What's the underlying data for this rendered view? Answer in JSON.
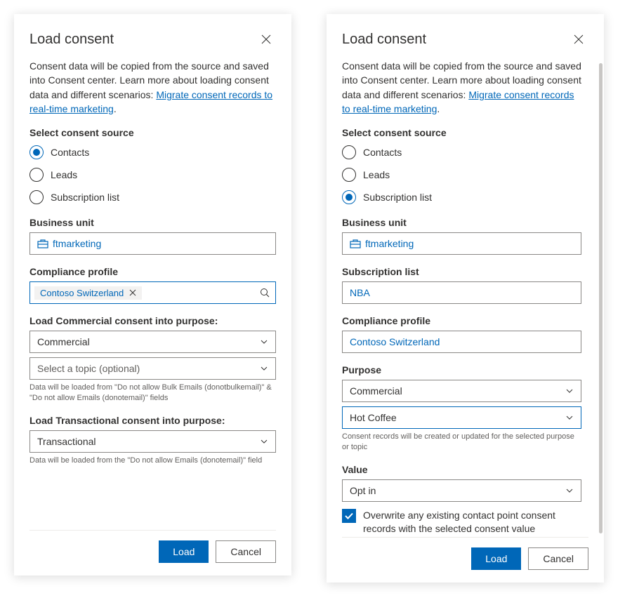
{
  "left": {
    "title": "Load consent",
    "intro_pre": "Consent data will be copied from the source and saved into Consent center. Learn more about loading consent data and different scenarios: ",
    "intro_link": "Migrate consent records to real-time marketing",
    "intro_post": ".",
    "source_label": "Select consent source",
    "radios": {
      "contacts": "Contacts",
      "leads": "Leads",
      "subscription": "Subscription list"
    },
    "bu_label": "Business unit",
    "bu_value": "ftmarketing",
    "compliance_label": "Compliance profile",
    "compliance_value": "Contoso Switzerland",
    "commercial_label": "Load Commercial consent into purpose:",
    "commercial_value": "Commercial",
    "topic_placeholder": "Select a topic (optional)",
    "commercial_helper": "Data will be loaded from \"Do not allow Bulk Emails (donotbulkemail)\" & \"Do not allow Emails (donotemail)\" fields",
    "transactional_label": "Load Transactional consent into purpose:",
    "transactional_value": "Transactional",
    "transactional_helper": "Data will be loaded from the \"Do not allow Emails (donotemail)\" field",
    "load_btn": "Load",
    "cancel_btn": "Cancel"
  },
  "right": {
    "title": "Load consent",
    "intro_pre": "Consent data will be copied from the source and saved into Consent center. Learn more about loading consent data and different scenarios: ",
    "intro_link": "Migrate consent records to real-time marketing",
    "intro_post": ".",
    "source_label": "Select consent source",
    "radios": {
      "contacts": "Contacts",
      "leads": "Leads",
      "subscription": "Subscription list"
    },
    "bu_label": "Business unit",
    "bu_value": "ftmarketing",
    "sublist_label": "Subscription list",
    "sublist_value": "NBA",
    "compliance_label": "Compliance profile",
    "compliance_value": "Contoso Switzerland",
    "purpose_label": "Purpose",
    "purpose_value": "Commercial",
    "topic_value": "Hot Coffee",
    "purpose_helper": "Consent records will be created or updated for the selected purpose or topic",
    "value_label": "Value",
    "value_value": "Opt in",
    "overwrite_label": "Overwrite any existing contact point consent records with the selected consent value",
    "load_btn": "Load",
    "cancel_btn": "Cancel"
  }
}
